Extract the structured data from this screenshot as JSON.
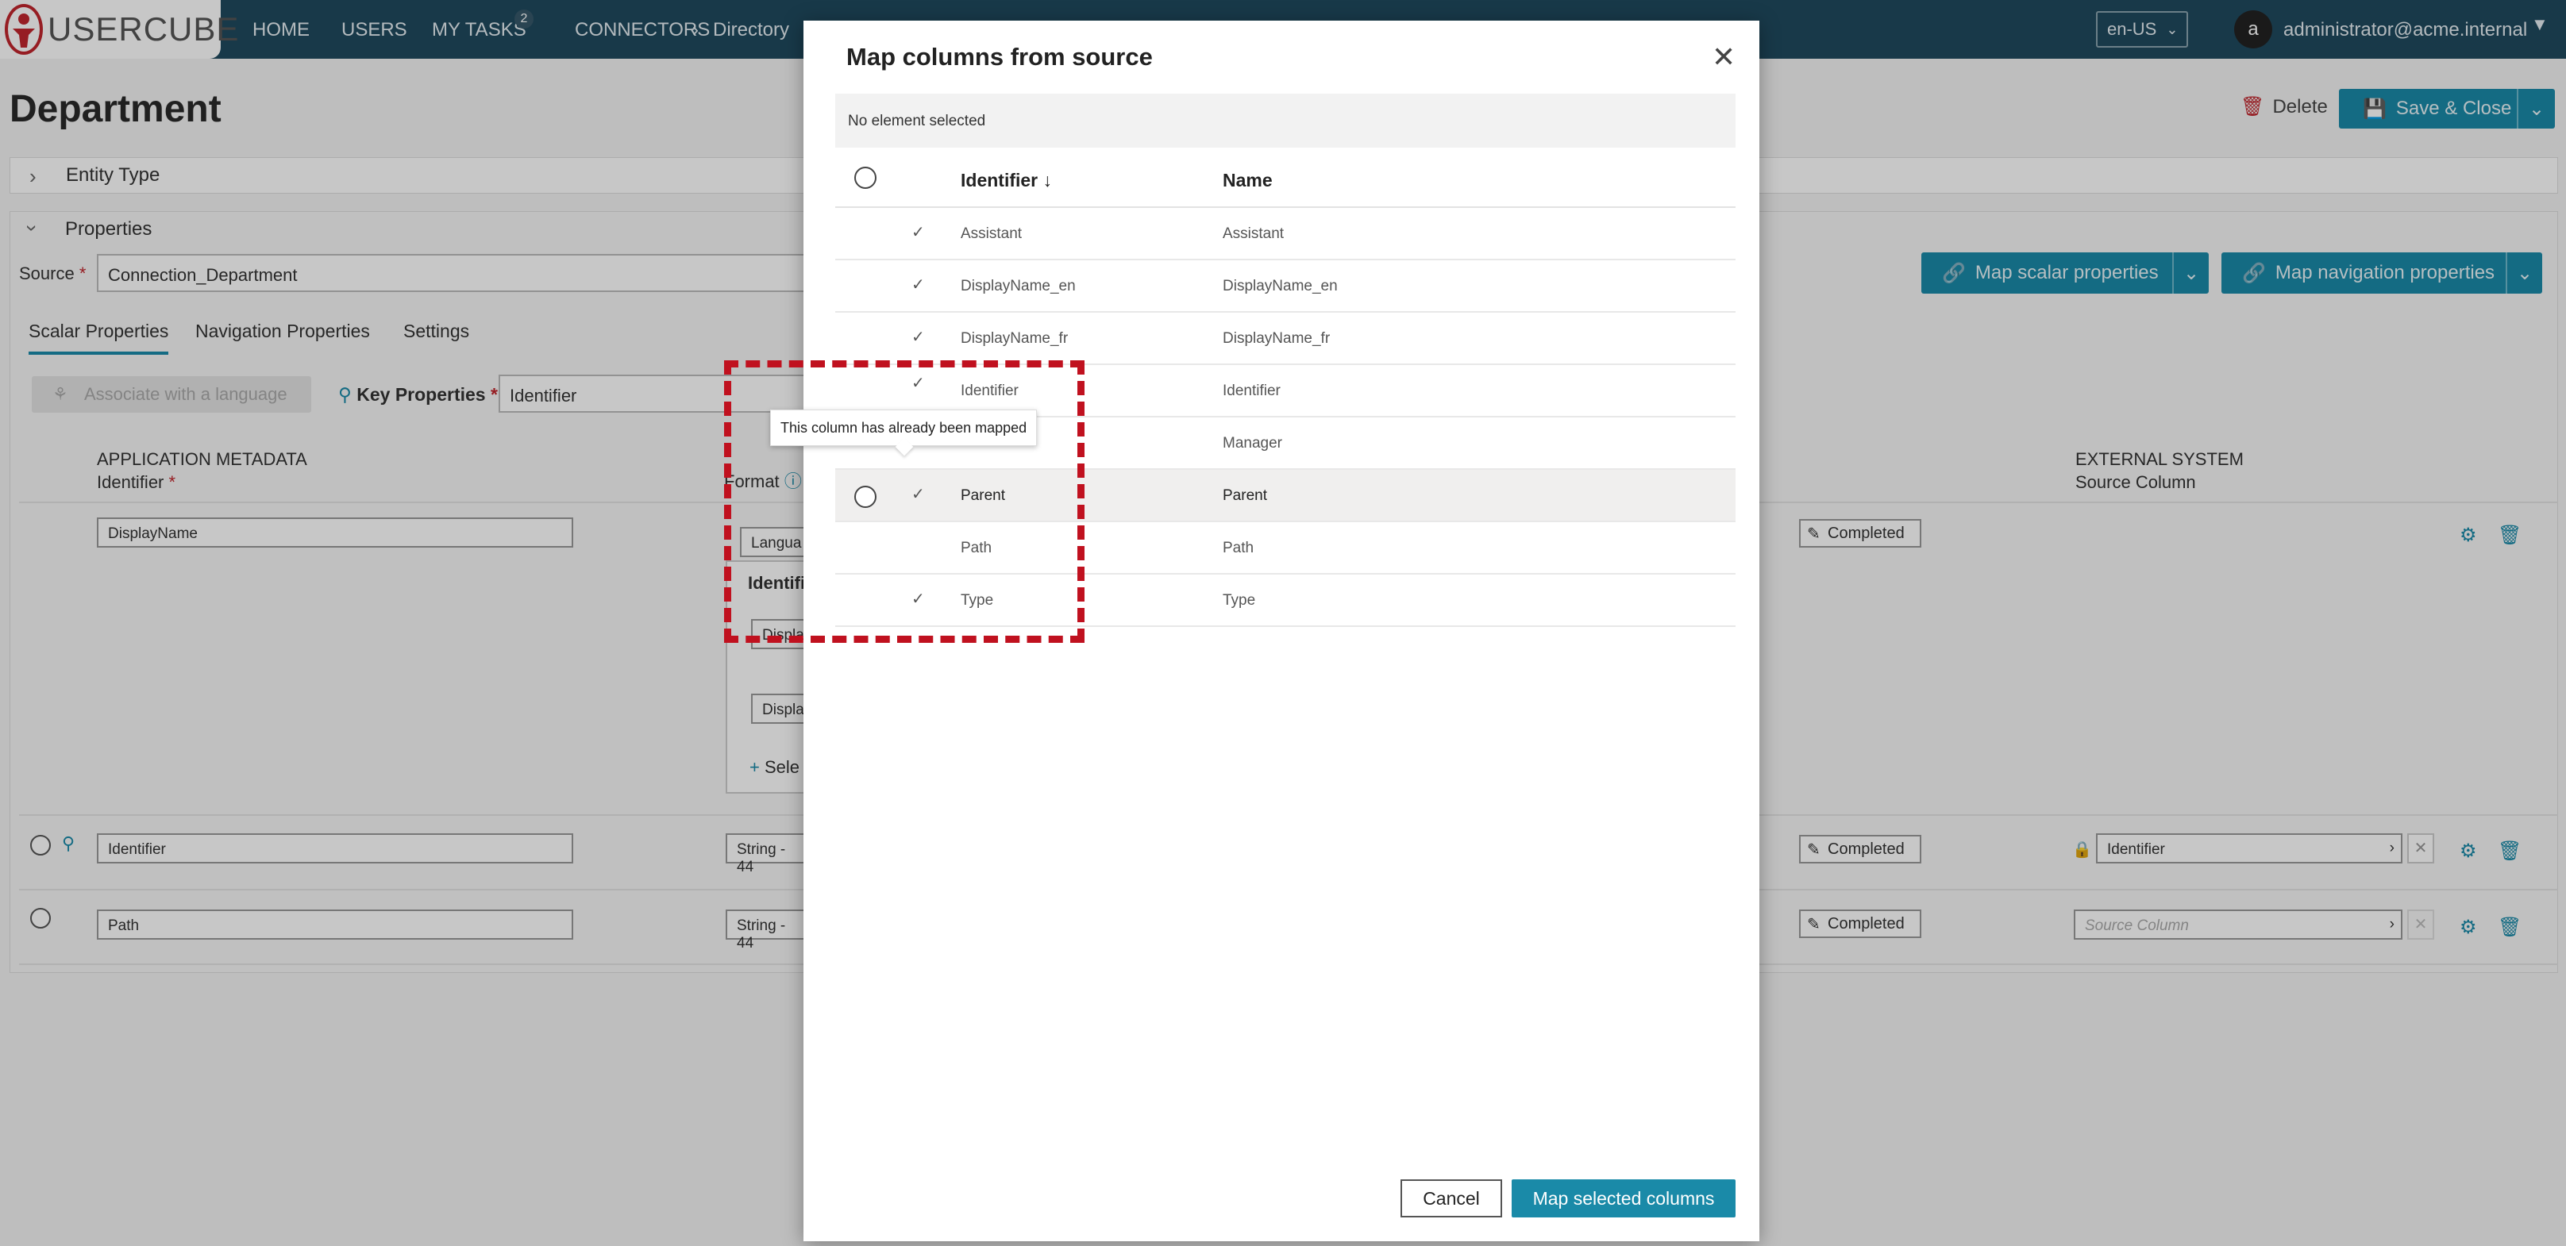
{
  "app": {
    "logo_text": "USERCUBE",
    "nav": [
      "HOME",
      "USERS",
      "MY TASKS",
      "CONNECTORS",
      "Directory"
    ],
    "tasks_badge": "2",
    "locale": "en-US",
    "avatar_letter": "a",
    "user": "administrator@acme.internal"
  },
  "page": {
    "title": "Department",
    "delete_label": "Delete",
    "save_label": "Save & Close",
    "entity_type_section": "Entity Type",
    "properties_section": "Properties",
    "source_label": "Source",
    "source_value": "Connection_Department",
    "map_scalar_label": "Map scalar properties",
    "map_navigation_label": "Map navigation properties",
    "tabs": [
      "Scalar Properties",
      "Navigation Properties",
      "Settings"
    ],
    "associate_label": "Associate with a language",
    "key_properties_label": "Key Properties",
    "key_properties_value": "Identifier",
    "columns": {
      "app_metadata": "APPLICATION METADATA",
      "identifier": "Identifier",
      "format": "Format",
      "external_system": "EXTERNAL SYSTEM",
      "source_column": "Source Column"
    },
    "rows": [
      {
        "identifier": "DisplayName",
        "format": "Langua",
        "status": "Completed"
      },
      {
        "identifier": "Identifier",
        "format": "String - 44",
        "status": "Completed",
        "source_column": "Identifier"
      },
      {
        "identifier": "Path",
        "format": "String - 44",
        "status": "Completed",
        "source_column_placeholder": "Source Column"
      }
    ],
    "nested": {
      "heading": "Identifi",
      "fields": [
        "Displa",
        "Display"
      ],
      "add_label": "Sele"
    }
  },
  "modal": {
    "title": "Map columns from source",
    "selection_status": "No element selected",
    "header_identifier": "Identifier",
    "header_name": "Name",
    "rows": [
      {
        "identifier": "Assistant",
        "name": "Assistant",
        "mapped": true
      },
      {
        "identifier": "DisplayName_en",
        "name": "DisplayName_en",
        "mapped": true
      },
      {
        "identifier": "DisplayName_fr",
        "name": "DisplayName_fr",
        "mapped": true
      },
      {
        "identifier": "Identifier",
        "name": "Identifier",
        "mapped": true
      },
      {
        "identifier": "",
        "name": "Manager",
        "mapped": false
      },
      {
        "identifier": "Parent",
        "name": "Parent",
        "mapped": true
      },
      {
        "identifier": "Path",
        "name": "Path",
        "mapped": false
      },
      {
        "identifier": "Type",
        "name": "Type",
        "mapped": true
      }
    ],
    "tooltip": "This column has already been mapped",
    "cancel_label": "Cancel",
    "confirm_label": "Map selected columns"
  }
}
